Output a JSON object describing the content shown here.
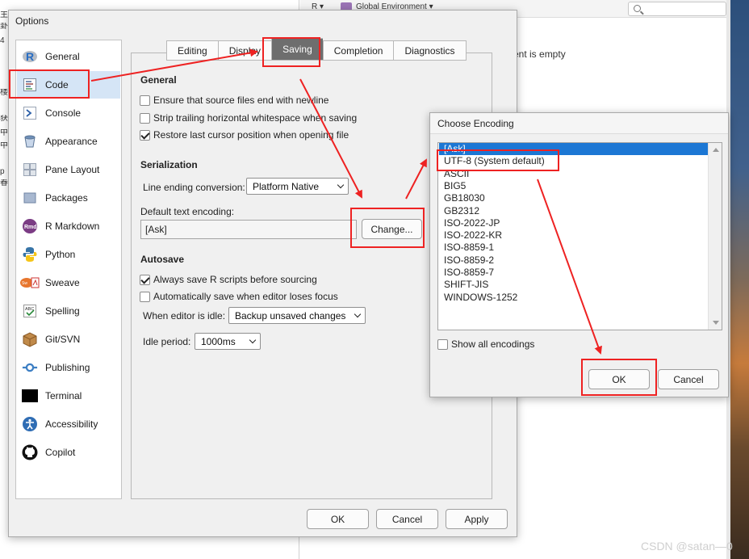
{
  "background": {
    "left_edge_glyphs": [
      "主",
      "卦",
      "4",
      "楼",
      "获",
      "中",
      "中",
      "p",
      "春"
    ],
    "env_toolbar": {
      "r_menu": "R ▾",
      "env_menu": "Global Environment ▾"
    },
    "env_empty_text": "ent is empty",
    "watermark": "CSDN @satan—0"
  },
  "options": {
    "title": "Options",
    "sidebar": [
      {
        "label": "General",
        "icon": "r-logo-icon"
      },
      {
        "label": "Code",
        "icon": "code-document-icon",
        "selected": true
      },
      {
        "label": "Console",
        "icon": "console-prompt-icon"
      },
      {
        "label": "Appearance",
        "icon": "appearance-bucket-icon"
      },
      {
        "label": "Pane Layout",
        "icon": "pane-layout-icon"
      },
      {
        "label": "Packages",
        "icon": "packages-box-icon"
      },
      {
        "label": "R Markdown",
        "icon": "rmd-icon"
      },
      {
        "label": "Python",
        "icon": "python-logo-icon"
      },
      {
        "label": "Sweave",
        "icon": "sweave-icon"
      },
      {
        "label": "Spelling",
        "icon": "spelling-abc-icon"
      },
      {
        "label": "Git/SVN",
        "icon": "git-box-icon"
      },
      {
        "label": "Publishing",
        "icon": "publishing-icon"
      },
      {
        "label": "Terminal",
        "icon": "terminal-icon"
      },
      {
        "label": "Accessibility",
        "icon": "accessibility-icon"
      },
      {
        "label": "Copilot",
        "icon": "github-icon"
      }
    ],
    "tabs": [
      "Editing",
      "Display",
      "Saving",
      "Completion",
      "Diagnostics"
    ],
    "active_tab": "Saving",
    "general": {
      "heading": "General",
      "checks": [
        {
          "label": "Ensure that source files end with newline",
          "checked": false
        },
        {
          "label": "Strip trailing horizontal whitespace when saving",
          "checked": false
        },
        {
          "label": "Restore last cursor position when opening file",
          "checked": true
        }
      ]
    },
    "serialization": {
      "heading": "Serialization",
      "line_ending_label": "Line ending conversion:",
      "line_ending_value": "Platform Native",
      "encoding_label": "Default text encoding:",
      "encoding_value": "[Ask]",
      "change_button": "Change..."
    },
    "autosave": {
      "heading": "Autosave",
      "checks": [
        {
          "label": "Always save R scripts before sourcing",
          "checked": true
        },
        {
          "label": "Automatically save when editor loses focus",
          "checked": false
        }
      ],
      "idle_label": "When editor is idle:",
      "idle_value": "Backup unsaved changes",
      "period_label": "Idle period:",
      "period_value": "1000ms"
    },
    "buttons": {
      "ok": "OK",
      "cancel": "Cancel",
      "apply": "Apply"
    }
  },
  "encoding_dialog": {
    "title": "Choose Encoding",
    "items": [
      "[Ask]",
      "UTF-8 (System default)",
      "ASCII",
      "BIG5",
      "GB18030",
      "GB2312",
      "ISO-2022-JP",
      "ISO-2022-KR",
      "ISO-8859-1",
      "ISO-8859-2",
      "ISO-8859-7",
      "SHIFT-JIS",
      "WINDOWS-1252"
    ],
    "selected_index": 0,
    "show_all_label": "Show all encodings",
    "show_all_checked": false,
    "ok": "OK",
    "cancel": "Cancel"
  },
  "annotation_color": "#ee2222",
  "selection_color": "#1c77d4"
}
